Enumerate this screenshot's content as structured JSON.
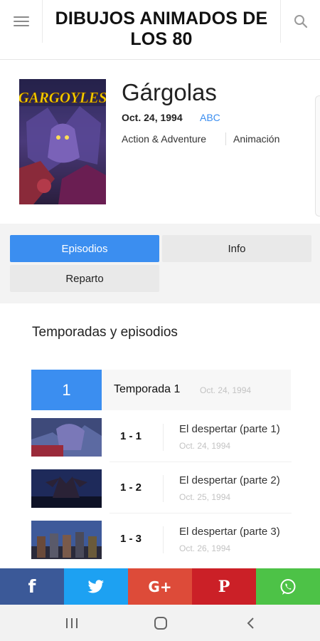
{
  "header": {
    "title": "DIBUJOS ANIMADOS DE LOS 80",
    "menu_icon": "hamburger-menu-icon",
    "search_icon": "search-icon"
  },
  "show": {
    "title": "Gárgolas",
    "date": "Oct. 24, 1994",
    "network": "ABC",
    "genres": [
      "Action & Adventure",
      "Animación"
    ],
    "poster_logo": "GARGOYLES"
  },
  "tabs": [
    {
      "label": "Episodios",
      "active": true
    },
    {
      "label": "Info",
      "active": false
    },
    {
      "label": "Reparto",
      "active": false
    }
  ],
  "episodes_section": {
    "title": "Temporadas y episodios",
    "season": {
      "number": "1",
      "label": "Temporada 1",
      "date": "Oct. 24, 1994"
    },
    "episodes": [
      {
        "number": "1 - 1",
        "title": "El despertar (parte 1)",
        "date": "Oct. 24, 1994"
      },
      {
        "number": "1 - 2",
        "title": "El despertar (parte 2)",
        "date": "Oct. 25, 1994"
      },
      {
        "number": "1 - 3",
        "title": "El despertar (parte 3)",
        "date": "Oct. 26, 1994"
      }
    ]
  },
  "share": [
    {
      "network": "facebook",
      "glyph": "f",
      "color": "#3b5998"
    },
    {
      "network": "twitter",
      "glyph": "",
      "color": "#1da1f2"
    },
    {
      "network": "google-plus",
      "glyph": "G+",
      "color": "#dd4b39"
    },
    {
      "network": "pinterest",
      "glyph": "P",
      "color": "#cb2027"
    },
    {
      "network": "whatsapp",
      "glyph": "",
      "color": "#4dc247"
    }
  ],
  "colors": {
    "accent": "#3b8ef0"
  }
}
